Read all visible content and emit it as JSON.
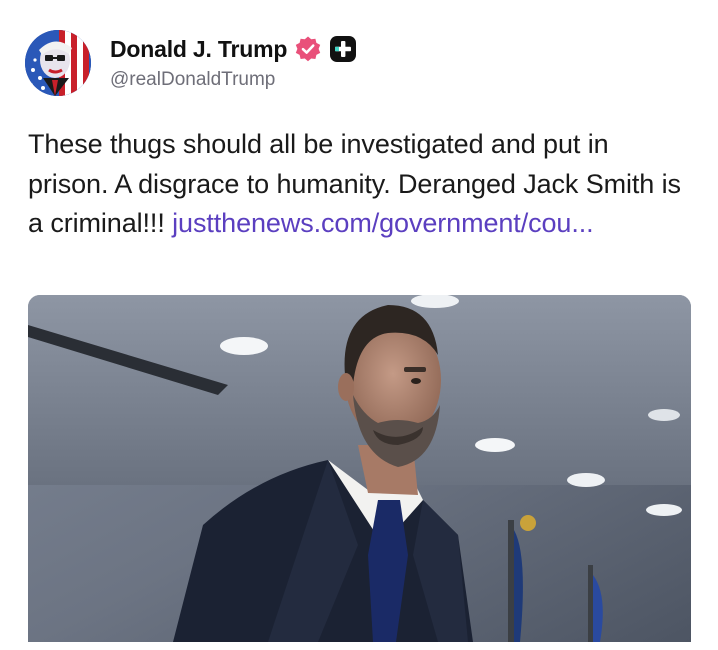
{
  "author": {
    "display_name": "Donald J. Trump",
    "handle": "@realDonaldTrump",
    "verified": true,
    "avatar_icon": "profile-portrait-avatar",
    "verified_icon": "verified-badge-icon",
    "plus_icon": "plus-badge-icon",
    "colors": {
      "verified": "#e9507a",
      "plus_badge": "#111111"
    }
  },
  "post": {
    "text": "These thugs should all be investigated and put in prison. A disgrace to humanity. Deranged Jack Smith is a criminal!!!",
    "link_text": "justthenews.com/government/cou...",
    "link_color": "#5b3fc0"
  },
  "media": {
    "type": "photo",
    "icon": "photo-man-in-suit-image"
  }
}
